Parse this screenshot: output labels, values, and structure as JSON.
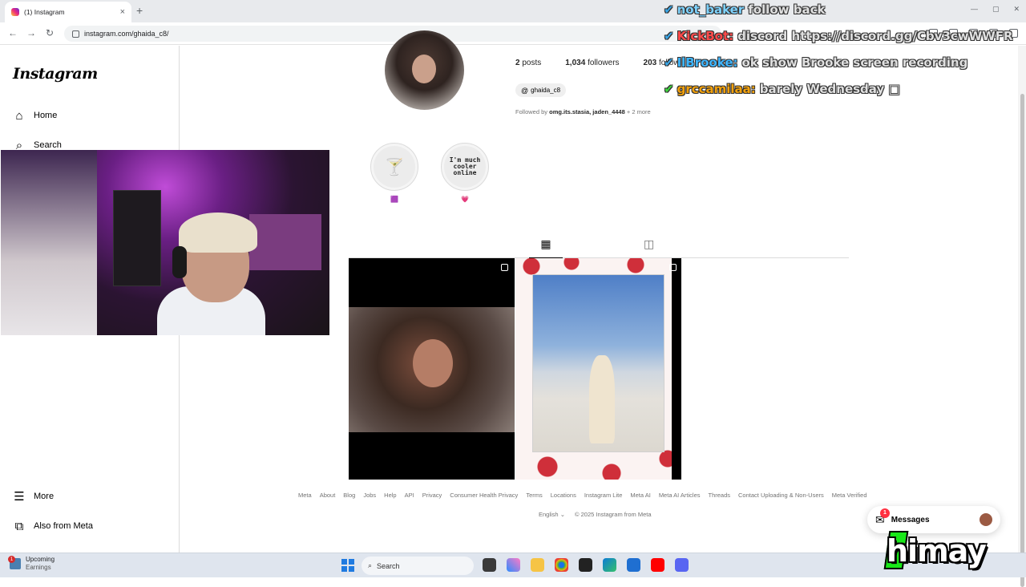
{
  "browser": {
    "tab_title": "(1) Instagram",
    "url": "instagram.com/ghaida_c8/",
    "new_tab_symbol": "+",
    "tab_close_symbol": "×"
  },
  "sidebar": {
    "logo": "Instagram",
    "items": [
      {
        "label": "Home",
        "icon": "home-icon"
      },
      {
        "label": "Search",
        "icon": "search-icon"
      },
      {
        "label": "More",
        "icon": "menu-icon"
      },
      {
        "label": "Also from Meta",
        "icon": "meta-apps-icon"
      }
    ]
  },
  "profile": {
    "posts_count": "2",
    "posts_label": "posts",
    "followers_count": "1,034",
    "followers_label": "followers",
    "following_count": "203",
    "following_label": "following",
    "threads_handle": "ghaida_c8",
    "followed_by_prefix": "Followed by",
    "followed_by_names": "omg.its.stasia, jaden_4448",
    "followed_by_more": "+ 2 more",
    "highlights": [
      {
        "cover_text": "",
        "label": "🟪"
      },
      {
        "cover_text": "I'm much cooler online",
        "label": "💗"
      }
    ]
  },
  "footer": {
    "links": [
      "Meta",
      "About",
      "Blog",
      "Jobs",
      "Help",
      "API",
      "Privacy",
      "Consumer Health Privacy",
      "Terms",
      "Locations",
      "Instagram Lite",
      "Meta AI",
      "Meta AI Articles",
      "Threads",
      "Contact Uploading & Non-Users",
      "Meta Verified"
    ],
    "language": "English",
    "copyright": "© 2025 Instagram from Meta"
  },
  "messages": {
    "label": "Messages",
    "badge": "1"
  },
  "chat": [
    {
      "user": "not_baker",
      "text": "follow back",
      "color": "#7fd3ff"
    },
    {
      "user": "KickBot:",
      "text": "discord https://discord.gg/Cbv3cwWWFR",
      "color": "#ff4a4a"
    },
    {
      "user": "IlBrooke:",
      "text": "ok show Brooke screen recording",
      "color": "#3fb6ff"
    },
    {
      "user": "grccamilaa:",
      "text": "barely Wednesday □",
      "color": "#f2a10c"
    }
  ],
  "taskbar": {
    "weather_title": "Upcoming",
    "weather_sub": "Earnings",
    "weather_badge": "1",
    "search_label": "Search"
  },
  "overlay": {
    "streamer_name": "himay"
  }
}
